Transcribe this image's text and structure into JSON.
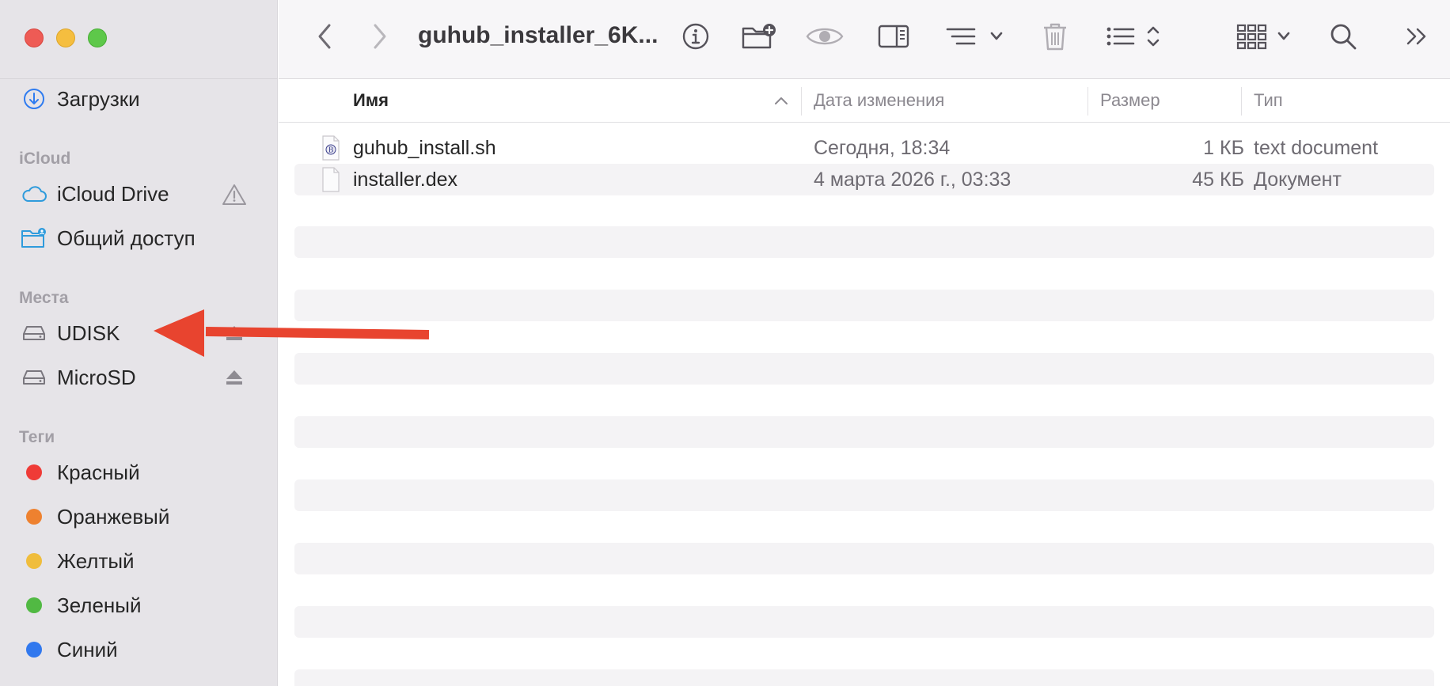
{
  "window": {
    "title": "guhub_installer_6K..."
  },
  "sidebar": {
    "downloads_label": "Загрузки",
    "icloud_section": "iCloud",
    "icloud_drive_label": "iCloud Drive",
    "shared_label": "Общий доступ",
    "places_section": "Места",
    "places": [
      {
        "label": "UDISK",
        "icon": "drive-icon"
      },
      {
        "label": "MicroSD",
        "icon": "drive-icon"
      }
    ],
    "tags_section": "Теги",
    "tags": [
      {
        "label": "Красный",
        "color": "#ef3b37"
      },
      {
        "label": "Оранжевый",
        "color": "#ee812f"
      },
      {
        "label": "Желтый",
        "color": "#f0bd3c"
      },
      {
        "label": "Зеленый",
        "color": "#51b943"
      },
      {
        "label": "Синий",
        "color": "#3178ee"
      }
    ]
  },
  "columns": {
    "name": "Имя",
    "date": "Дата изменения",
    "size": "Размер",
    "kind": "Тип"
  },
  "files": [
    {
      "name": "guhub_install.sh",
      "date": "Сегодня, 18:34",
      "size": "1 КБ",
      "kind": "text document",
      "icon": "shell-script-icon"
    },
    {
      "name": "installer.dex",
      "date": "4 марта 2026 г., 03:33",
      "size": "45 КБ",
      "kind": "Документ",
      "icon": "blank-document-icon"
    }
  ],
  "colors": {
    "sidebar_bg": "#e6e4e8",
    "annotation_arrow": "#e8442f",
    "accent_blue": "#2f7cf0"
  }
}
